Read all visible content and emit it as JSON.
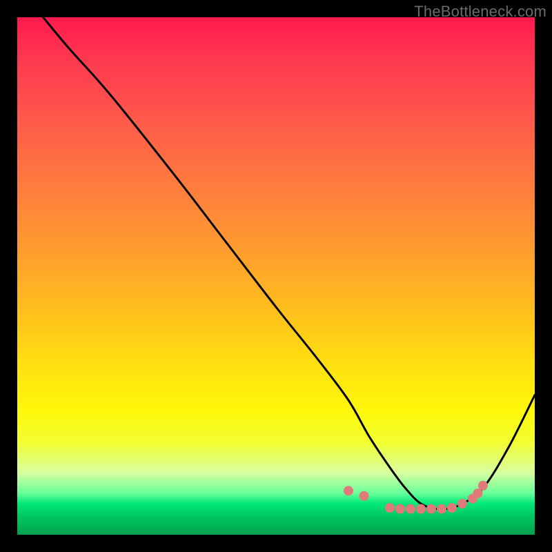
{
  "watermark": "TheBottleneck.com",
  "chart_data": {
    "type": "line",
    "title": "",
    "xlabel": "",
    "ylabel": "",
    "xlim": [
      0,
      100
    ],
    "ylim": [
      0,
      100
    ],
    "grid": false,
    "background": "gradient-red-green",
    "series": [
      {
        "name": "curve",
        "color": "#000000",
        "x": [
          5,
          10,
          18,
          30,
          40,
          50,
          58,
          64,
          68,
          72,
          75,
          78,
          81,
          83,
          86,
          90,
          95,
          100
        ],
        "y": [
          100,
          94,
          85,
          70,
          57,
          44,
          34,
          26,
          19,
          13,
          9,
          6,
          5,
          5,
          6,
          9,
          17,
          27
        ]
      }
    ],
    "markers": {
      "name": "dots",
      "color": "#e07a7a",
      "radius_px": 7,
      "x": [
        64,
        67,
        72,
        74,
        76,
        78,
        80,
        82,
        84,
        86,
        88,
        89,
        90
      ],
      "y": [
        8.5,
        7.5,
        5.2,
        5,
        5,
        5,
        5,
        5,
        5.2,
        6,
        7,
        8,
        9.5
      ]
    }
  }
}
